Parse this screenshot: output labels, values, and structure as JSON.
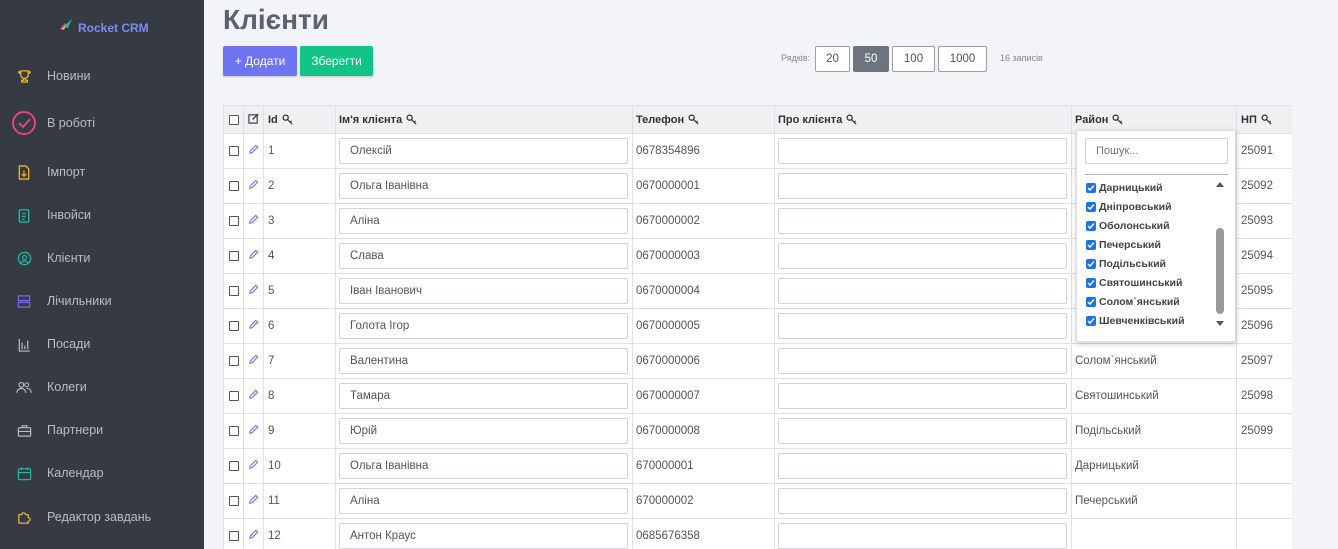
{
  "brand": {
    "name": "Rocket CRM"
  },
  "sidebar": {
    "items": [
      {
        "label": "Новини",
        "icon": "trophy-icon"
      },
      {
        "label": "В роботі",
        "icon": "check-circle-icon"
      },
      {
        "label": "Імпорт",
        "icon": "file-import-icon"
      },
      {
        "label": "Інвойси",
        "icon": "clipboard-icon"
      },
      {
        "label": "Клієнти",
        "icon": "user-circle-icon"
      },
      {
        "label": "Лічильники",
        "icon": "server-icon"
      },
      {
        "label": "Посади",
        "icon": "bar-chart-icon"
      },
      {
        "label": "Колеги",
        "icon": "users-icon"
      },
      {
        "label": "Партнери",
        "icon": "briefcase-icon"
      },
      {
        "label": "Календар",
        "icon": "calendar-icon"
      },
      {
        "label": "Редактор завдань",
        "icon": "puzzle-icon"
      }
    ]
  },
  "page": {
    "title": "Клієнти"
  },
  "toolbar": {
    "add_label": "+ Додати",
    "save_label": "Зберегти"
  },
  "pagination": {
    "rows_label": "Рядків:",
    "options": [
      "20",
      "50",
      "100",
      "1000"
    ],
    "selected": "50",
    "records_label": "16 записів"
  },
  "table": {
    "headers": {
      "id": "Id",
      "name": "Ім'я клієнта",
      "phone": "Телефон",
      "about": "Про клієнта",
      "district": "Район",
      "np": "НП"
    },
    "rows": [
      {
        "id": "1",
        "name": "Олексій",
        "phone": "0678354896",
        "about": "",
        "district": "",
        "np": "25091"
      },
      {
        "id": "2",
        "name": "Ольга Іванівна",
        "phone": "0670000001",
        "about": "",
        "district": "",
        "np": "25092"
      },
      {
        "id": "3",
        "name": "Аліна",
        "phone": "0670000002",
        "about": "",
        "district": "",
        "np": "25093"
      },
      {
        "id": "4",
        "name": "Слава",
        "phone": "0670000003",
        "about": "",
        "district": "",
        "np": "25094"
      },
      {
        "id": "5",
        "name": "Іван Іванович",
        "phone": "0670000004",
        "about": "",
        "district": "",
        "np": "25095"
      },
      {
        "id": "6",
        "name": "Голота Ігор",
        "phone": "0670000005",
        "about": "",
        "district": "",
        "np": "25096"
      },
      {
        "id": "7",
        "name": "Валентина",
        "phone": "0670000006",
        "about": "",
        "district": "Солом`янський",
        "np": "25097"
      },
      {
        "id": "8",
        "name": "Тамара",
        "phone": "0670000007",
        "about": "",
        "district": "Святошинський",
        "np": "25098"
      },
      {
        "id": "9",
        "name": "Юрій",
        "phone": "0670000008",
        "about": "",
        "district": "Подільський",
        "np": "25099"
      },
      {
        "id": "10",
        "name": "Ольга Іванівна",
        "phone": "670000001",
        "about": "",
        "district": "Дарницький",
        "np": ""
      },
      {
        "id": "11",
        "name": "Аліна",
        "phone": "670000002",
        "about": "",
        "district": "Печерський",
        "np": ""
      },
      {
        "id": "12",
        "name": "Антон Краус",
        "phone": "0685676358",
        "about": "",
        "district": "",
        "np": ""
      }
    ]
  },
  "district_filter": {
    "search_placeholder": "Пошук...",
    "options": [
      "Дарницький",
      "Дніпровський",
      "Оболонський",
      "Печерський",
      "Подільський",
      "Святошинський",
      "Солом`янський",
      "Шевченківський"
    ]
  },
  "colors": {
    "sidebar_bg": "#363a43",
    "accent": "#6f74f2",
    "save": "#12c488",
    "icon_yellow": "#f0b429",
    "icon_teal": "#1fb8a6",
    "icon_pink": "#e0457b",
    "icon_purple": "#7c6cf0"
  }
}
